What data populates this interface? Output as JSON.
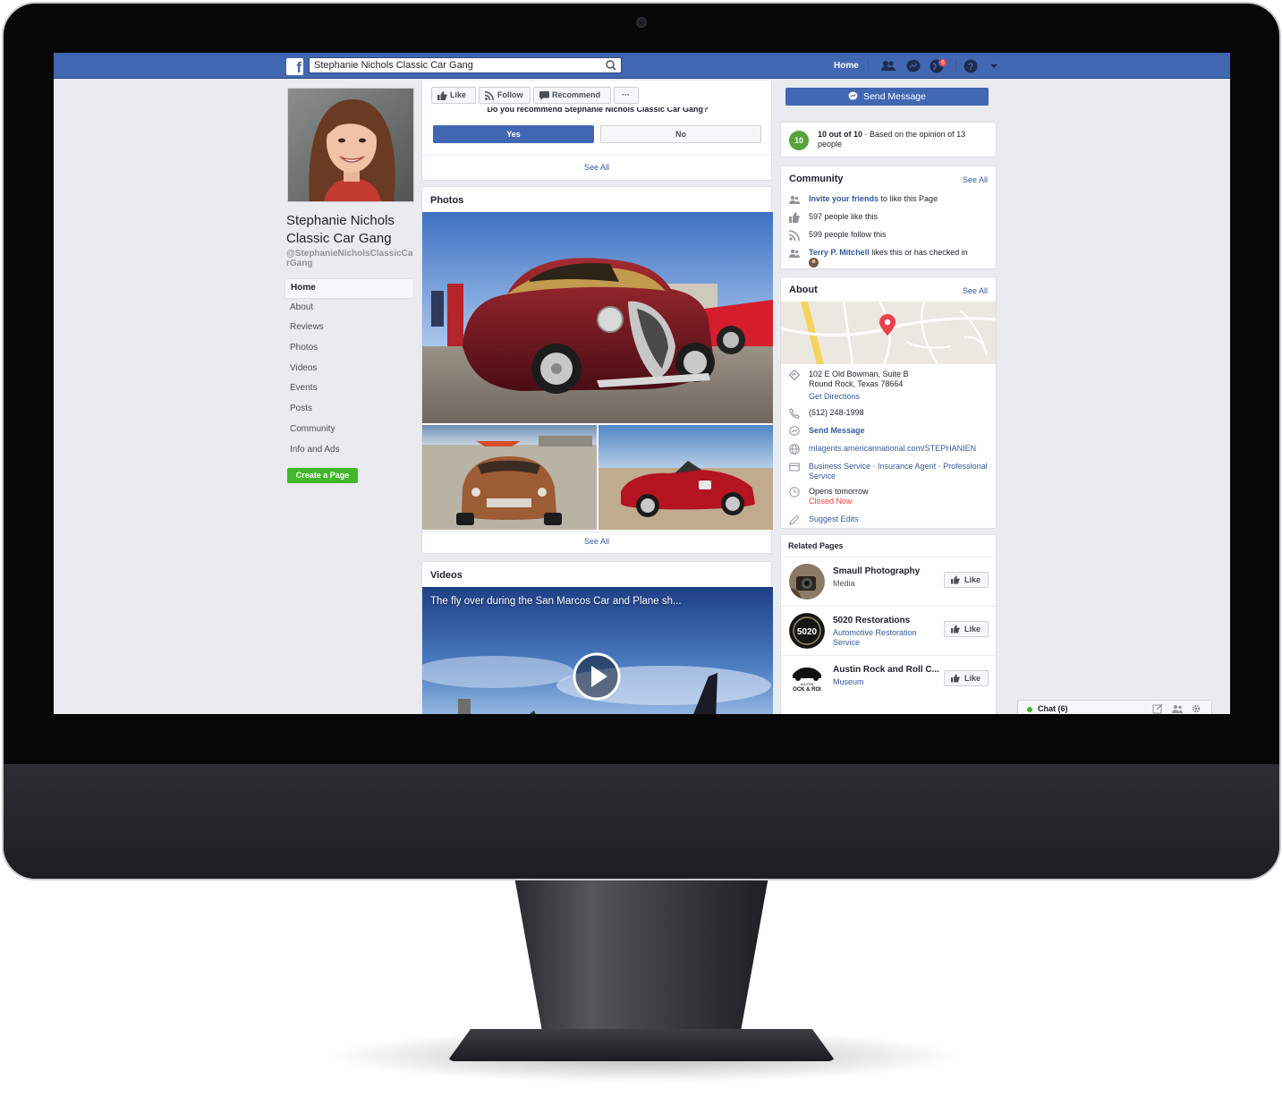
{
  "browser": {
    "search_value": "Stephanie Nichols Classic Car Gang",
    "nav_home": "Home",
    "notification_count": "6"
  },
  "profile": {
    "name": "Stephanie Nichols Classic Car Gang",
    "handle": "@StephanieNicholsClassicCarGang",
    "create_page": "Create a Page"
  },
  "left_nav": [
    {
      "label": "Home",
      "active": true
    },
    {
      "label": "About"
    },
    {
      "label": "Reviews"
    },
    {
      "label": "Photos"
    },
    {
      "label": "Videos"
    },
    {
      "label": "Events"
    },
    {
      "label": "Posts"
    },
    {
      "label": "Community"
    },
    {
      "label": "Info and Ads"
    }
  ],
  "actions": {
    "like": "Like",
    "follow": "Follow",
    "recommend": "Recommend",
    "more": "···"
  },
  "recommend": {
    "question": "Do you recommend Stephanie Nichols Classic Car Gang?",
    "yes": "Yes",
    "no": "No",
    "see_all": "See All"
  },
  "photos": {
    "title": "Photos",
    "see_all": "See All"
  },
  "videos": {
    "title": "Videos",
    "video_title": "The fly over during the San Marcos Car and Plane sh..."
  },
  "right": {
    "send_message": "Send Message",
    "rating": {
      "score": "10",
      "bold": "10 out of 10",
      "rest": " · Based on the opinion of 13 people"
    },
    "community": {
      "title": "Community",
      "see_all": "See All",
      "invite_link": "Invite your friends",
      "invite_rest": " to like this Page",
      "likes": "597 people like this",
      "follows": "599 people follow this",
      "friend_link": "Terry P. Mitchell",
      "friend_rest": " likes this or has checked in"
    },
    "about": {
      "title": "About",
      "see_all": "See All",
      "address_line1": "102 E Old Bowman, Suite B",
      "address_line2": "Round Rock, Texas 78664",
      "directions": "Get Directions",
      "phone": "(512) 248-1998",
      "send_message": "Send Message",
      "website": "mlagents.americannational.com/STEPHANIEN",
      "categories": "Business Service · Insurance Agent · Professional Service",
      "hours": "Opens tomorrow",
      "status": "Closed Now",
      "suggest_edits": "Suggest Edits"
    },
    "related": {
      "title": "Related Pages",
      "like_label": "Like",
      "items": [
        {
          "name": "Smaull Photography",
          "category": "Media"
        },
        {
          "name": "5020 Restorations",
          "category": "Automotive Restoration Service"
        },
        {
          "name": "Austin Rock and Roll C...",
          "category": "Museum"
        }
      ]
    }
  },
  "thumb_labels": {
    "t5020": "5020",
    "rock_small": "AUSTIN",
    "rock_big": "OCK & ROI"
  },
  "chat": {
    "label": "Chat (6)"
  },
  "colors": {
    "facebook_blue": "#4267b2",
    "link_blue": "#365899",
    "green": "#42b72a",
    "rating_green": "#58a33b",
    "closed_red": "#fa3e3e"
  }
}
